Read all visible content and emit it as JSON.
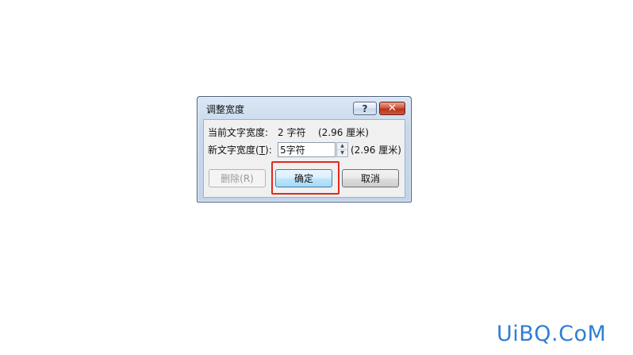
{
  "dialog": {
    "title": "调整宽度",
    "help_label": "?",
    "close_label": "✕",
    "current_width_label": "当前文字宽度:",
    "current_width_value": "2 字符",
    "current_width_cm": "(2.96 厘米)",
    "new_width_label_prefix": "新文字宽度(",
    "new_width_label_key": "T",
    "new_width_label_suffix": "):",
    "new_width_value": "5字符",
    "new_width_cm": "(2.96 厘米)",
    "spin_up_icon": "▲",
    "spin_down_icon": "▼",
    "delete_label": "删除(R)",
    "ok_label": "确定",
    "cancel_label": "取消"
  },
  "annotation": {
    "highlight_color": "#e02a1f"
  },
  "watermark": {
    "text": "UiBQ.CoM"
  }
}
